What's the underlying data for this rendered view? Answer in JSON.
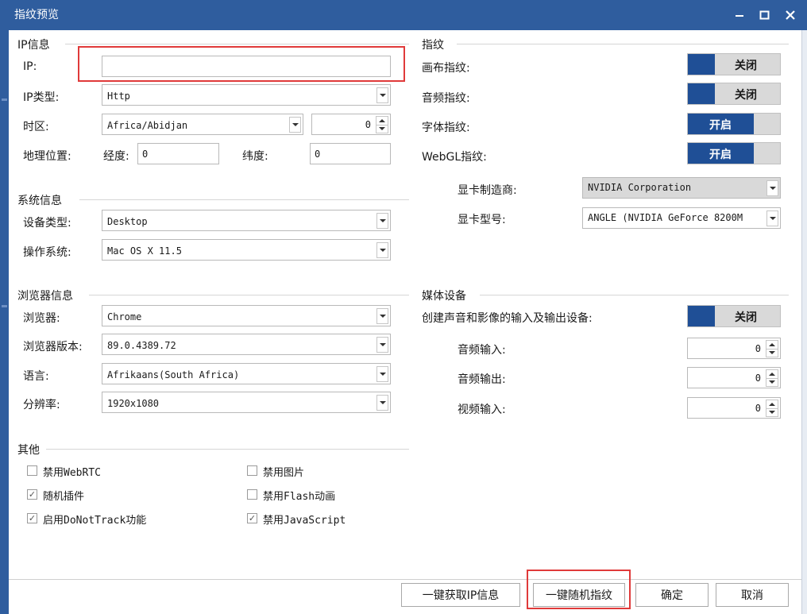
{
  "window": {
    "title": "指纹预览",
    "minimize": "–",
    "maximize": "□",
    "close": "✕"
  },
  "ip_section": {
    "title": "IP信息",
    "ip_label": "IP:",
    "ip_value": "",
    "type_label": "IP类型:",
    "type_value": "Http",
    "tz_label": "时区:",
    "tz_value": "Africa/Abidjan",
    "tz_offset": "0",
    "geo_label": "地理位置:",
    "lon_label": "经度:",
    "lon_value": "0",
    "lat_label": "纬度:",
    "lat_value": "0"
  },
  "system_section": {
    "title": "系统信息",
    "device_label": "设备类型:",
    "device_value": "Desktop",
    "os_label": "操作系统:",
    "os_value": "Mac OS X 11.5"
  },
  "browser_section": {
    "title": "浏览器信息",
    "browser_label": "浏览器:",
    "browser_value": "Chrome",
    "version_label": "浏览器版本:",
    "version_value": "89.0.4389.72",
    "lang_label": "语言:",
    "lang_value": "Afrikaans(South Africa)",
    "res_label": "分辨率:",
    "res_value": "1920x1080"
  },
  "other_section": {
    "title": "其他",
    "checkboxes": [
      {
        "label": "禁用WebRTC",
        "checked": false
      },
      {
        "label": "禁用图片",
        "checked": false
      },
      {
        "label": "随机插件",
        "checked": true
      },
      {
        "label": "禁用Flash动画",
        "checked": false
      },
      {
        "label": "启用DoNotTrack功能",
        "checked": true
      },
      {
        "label": "禁用JavaScript",
        "checked": true
      }
    ],
    "check_mark": "✓"
  },
  "fingerprint_section": {
    "title": "指纹",
    "canvas_label": "画布指纹:",
    "canvas_state": "关闭",
    "audio_label": "音频指纹:",
    "audio_state": "关闭",
    "font_label": "字体指纹:",
    "font_state": "开启",
    "webgl_label": "WebGL指纹:",
    "webgl_state": "开启",
    "gpu_vendor_label": "显卡制造商:",
    "gpu_vendor_value": "NVIDIA Corporation",
    "gpu_model_label": "显卡型号:",
    "gpu_model_value": "ANGLE (NVIDIA GeForce 8200M"
  },
  "media_section": {
    "title": "媒体设备",
    "create_label": "创建声音和影像的输入及输出设备:",
    "create_state": "关闭",
    "audio_in_label": "音频输入:",
    "audio_in_value": "0",
    "audio_out_label": "音频输出:",
    "audio_out_value": "0",
    "video_in_label": "视频输入:",
    "video_in_value": "0"
  },
  "footer": {
    "get_ip_label": "一键获取IP信息",
    "random_label": "一键随机指纹",
    "ok_label": "确定",
    "cancel_label": "取消"
  },
  "colors": {
    "titlebar": "#2f5d9e",
    "toggle_on": "#1f4f96",
    "toggle_off": "#d9d9d9",
    "highlight": "#e03a3a"
  }
}
